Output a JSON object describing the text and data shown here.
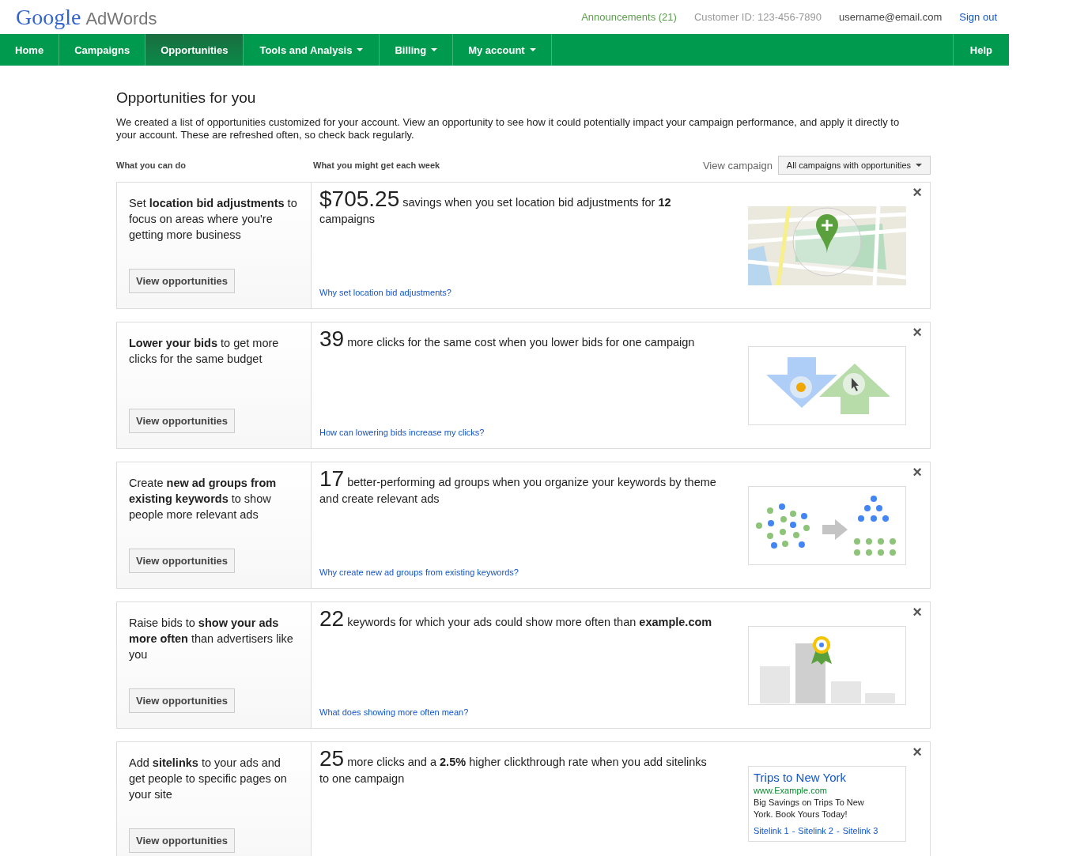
{
  "header": {
    "logo": "Google",
    "product": "AdWords",
    "announcements": "Announcements (21)",
    "customer_id": "Customer ID: 123-456-7890",
    "email": "username@email.com",
    "sign_out": "Sign out"
  },
  "nav": {
    "items": [
      {
        "label": "Home",
        "selected": false,
        "dropdown": false
      },
      {
        "label": "Campaigns",
        "selected": false,
        "dropdown": false
      },
      {
        "label": "Opportunities",
        "selected": true,
        "dropdown": false
      },
      {
        "label": "Tools and Analysis",
        "selected": false,
        "dropdown": true
      },
      {
        "label": "Billing",
        "selected": false,
        "dropdown": true
      },
      {
        "label": "My account",
        "selected": false,
        "dropdown": true
      }
    ],
    "help": "Help"
  },
  "page": {
    "title": "Opportunities for you",
    "intro": "We created a list of opportunities customized for your account. View an opportunity to see how it could potentially impact your campaign performance, and apply it directly to your account. These are refreshed often, so check back regularly."
  },
  "columns": {
    "left": "What you can do",
    "middle": "What you might get each week",
    "view_label": "View campaign",
    "view_select": "All campaigns with opportunities"
  },
  "cards": [
    {
      "kind": "map",
      "action": "Set **location bid adjustments** to focus on areas where you're getting more business",
      "button": "View opportunities",
      "figure": "$705.25",
      "benefit": "savings when you set location bid adjustments for **12** campaigns",
      "link": "Why set location bid adjustments?",
      "close": "×"
    },
    {
      "kind": "arrows",
      "action": "**Lower your bids** to get more clicks for the same budget",
      "button": "View opportunities",
      "figure": "39",
      "benefit": "more clicks for the same cost when you lower bids for one campaign",
      "link": "How can lowering bids increase my clicks?",
      "close": "×"
    },
    {
      "kind": "dots",
      "action": "Create **new ad groups from existing keywords** to show people more relevant ads",
      "button": "View opportunities",
      "figure": "17",
      "benefit": "better-performing ad groups when you organize your keywords by theme and create relevant ads",
      "link": "Why create new ad groups from existing keywords?",
      "close": "×"
    },
    {
      "kind": "bars",
      "action": "Raise bids to **show your ads more often** than advertisers like you",
      "button": "View opportunities",
      "figure": "22",
      "benefit": "keywords for which your ads could show more often than **example.com**",
      "link": "What does showing more often mean?",
      "close": "×"
    },
    {
      "kind": "ad",
      "action": "Add **sitelinks** to your ads and get people to specific pages on your site",
      "button": "View opportunities",
      "figure": "25",
      "benefit": "more clicks and a **2.5%** higher clickthrough rate when you add sitelinks to one campaign",
      "close": "×",
      "ad": {
        "title": "Trips to New York",
        "url": "www.Example.com",
        "text": "Big Savings on Trips To New York. Book Yours Today!",
        "sitelinks": [
          "Sitelink 1",
          "Sitelink 2",
          "Sitelink 3"
        ],
        "separators": [
          "-",
          "-"
        ]
      }
    }
  ]
}
